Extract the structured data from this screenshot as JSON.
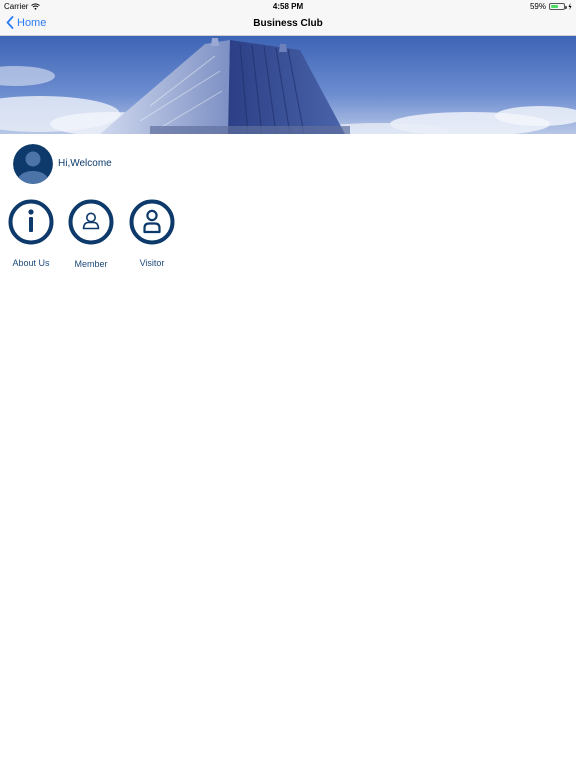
{
  "status_bar": {
    "carrier": "Carrier",
    "time": "4:58 PM",
    "battery_percent": "59%",
    "battery_level": 0.59
  },
  "nav": {
    "back_label": "Home",
    "title": "Business Club",
    "accent_color": "#2a7cf3"
  },
  "welcome": {
    "text": "Hi,Welcome"
  },
  "menu": {
    "items": [
      {
        "label": "About Us",
        "icon": "info-icon"
      },
      {
        "label": "Member",
        "icon": "member-icon"
      },
      {
        "label": "Visitor",
        "icon": "visitor-icon"
      }
    ]
  },
  "theme": {
    "primary": "#0d3a6b"
  }
}
